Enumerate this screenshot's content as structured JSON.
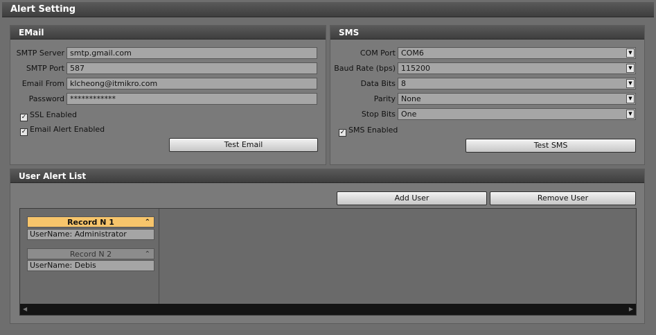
{
  "window": {
    "title": "Alert Setting"
  },
  "email": {
    "title": "EMail",
    "smtp_server_label": "SMTP Server",
    "smtp_server": "smtp.gmail.com",
    "smtp_port_label": "SMTP Port",
    "smtp_port": "587",
    "email_from_label": "Email From",
    "email_from": "klcheong@itmikro.com",
    "password_label": "Password",
    "password": "************",
    "ssl_label": "SSL Enabled",
    "ssl_checked": true,
    "alert_label": "Email Alert Enabled",
    "alert_checked": true,
    "test_button": "Test Email"
  },
  "sms": {
    "title": "SMS",
    "com_port_label": "COM Port",
    "com_port": "COM6",
    "baud_rate_label": "Baud Rate (bps)",
    "baud_rate": "115200",
    "data_bits_label": "Data Bits",
    "data_bits": "8",
    "parity_label": "Parity",
    "parity": "None",
    "stop_bits_label": "Stop Bits",
    "stop_bits": "One",
    "enabled_label": "SMS Enabled",
    "enabled_checked": true,
    "test_button": "Test SMS"
  },
  "user_list": {
    "title": "User Alert List",
    "add_button": "Add User",
    "remove_button": "Remove User",
    "records": [
      {
        "header": "Record N 1",
        "username": "UserName:  Administrator",
        "selected": true
      },
      {
        "header": "Record N 2",
        "username": "UserName:  Debis",
        "selected": false
      }
    ]
  },
  "glyphs": {
    "check": "✓",
    "dropdown": "▼",
    "collapse": "⌃",
    "scroll_left": "◀",
    "scroll_right": "▶"
  },
  "colors": {
    "selected_record": "#f7c56b",
    "unselected_record": "#8c8c8c",
    "field_bg": "#a6a6a6"
  }
}
